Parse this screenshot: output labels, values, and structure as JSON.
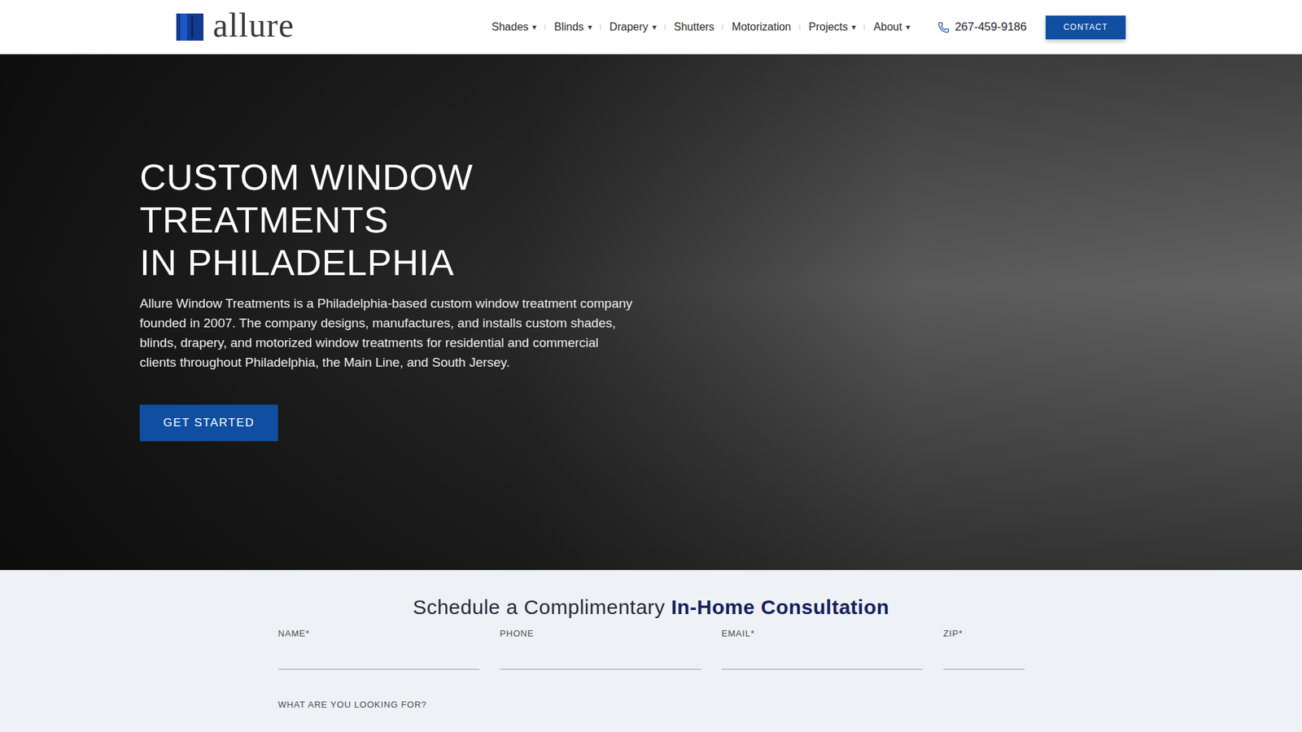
{
  "header": {
    "logo": "allure",
    "nav": [
      {
        "label": "Shades",
        "dropdown": true
      },
      {
        "label": "Blinds",
        "dropdown": true
      },
      {
        "label": "Drapery",
        "dropdown": true
      },
      {
        "label": "Shutters",
        "dropdown": false
      },
      {
        "label": "Motorization",
        "dropdown": false
      },
      {
        "label": "Projects",
        "dropdown": true
      },
      {
        "label": "About",
        "dropdown": true
      }
    ],
    "caret": "▾",
    "phone": "267-459-9186",
    "contact": "CONTACT"
  },
  "hero": {
    "title_lines": [
      "CUSTOM WINDOW",
      "TREATMENTS",
      "IN PHILADELPHIA"
    ],
    "text": "Allure Window Treatments is a Philadelphia-based custom window treatment company founded in 2007. The company designs, manufactures, and installs custom shades, blinds, drapery, and motorized window treatments for residential and commercial clients throughout Philadelphia, the Main Line, and South Jersey.",
    "button": "GET STARTED"
  },
  "form": {
    "title_plain": "Schedule a Complimentary",
    "title_bold": "In-Home Consultation",
    "required_mark": "*",
    "fields": [
      {
        "label": "NAME",
        "required": true
      },
      {
        "label": "PHONE",
        "required": false
      },
      {
        "label": "EMAIL",
        "required": true
      },
      {
        "label": "ZIP",
        "required": true
      }
    ],
    "question": "WHAT ARE YOU LOOKING FOR?"
  }
}
